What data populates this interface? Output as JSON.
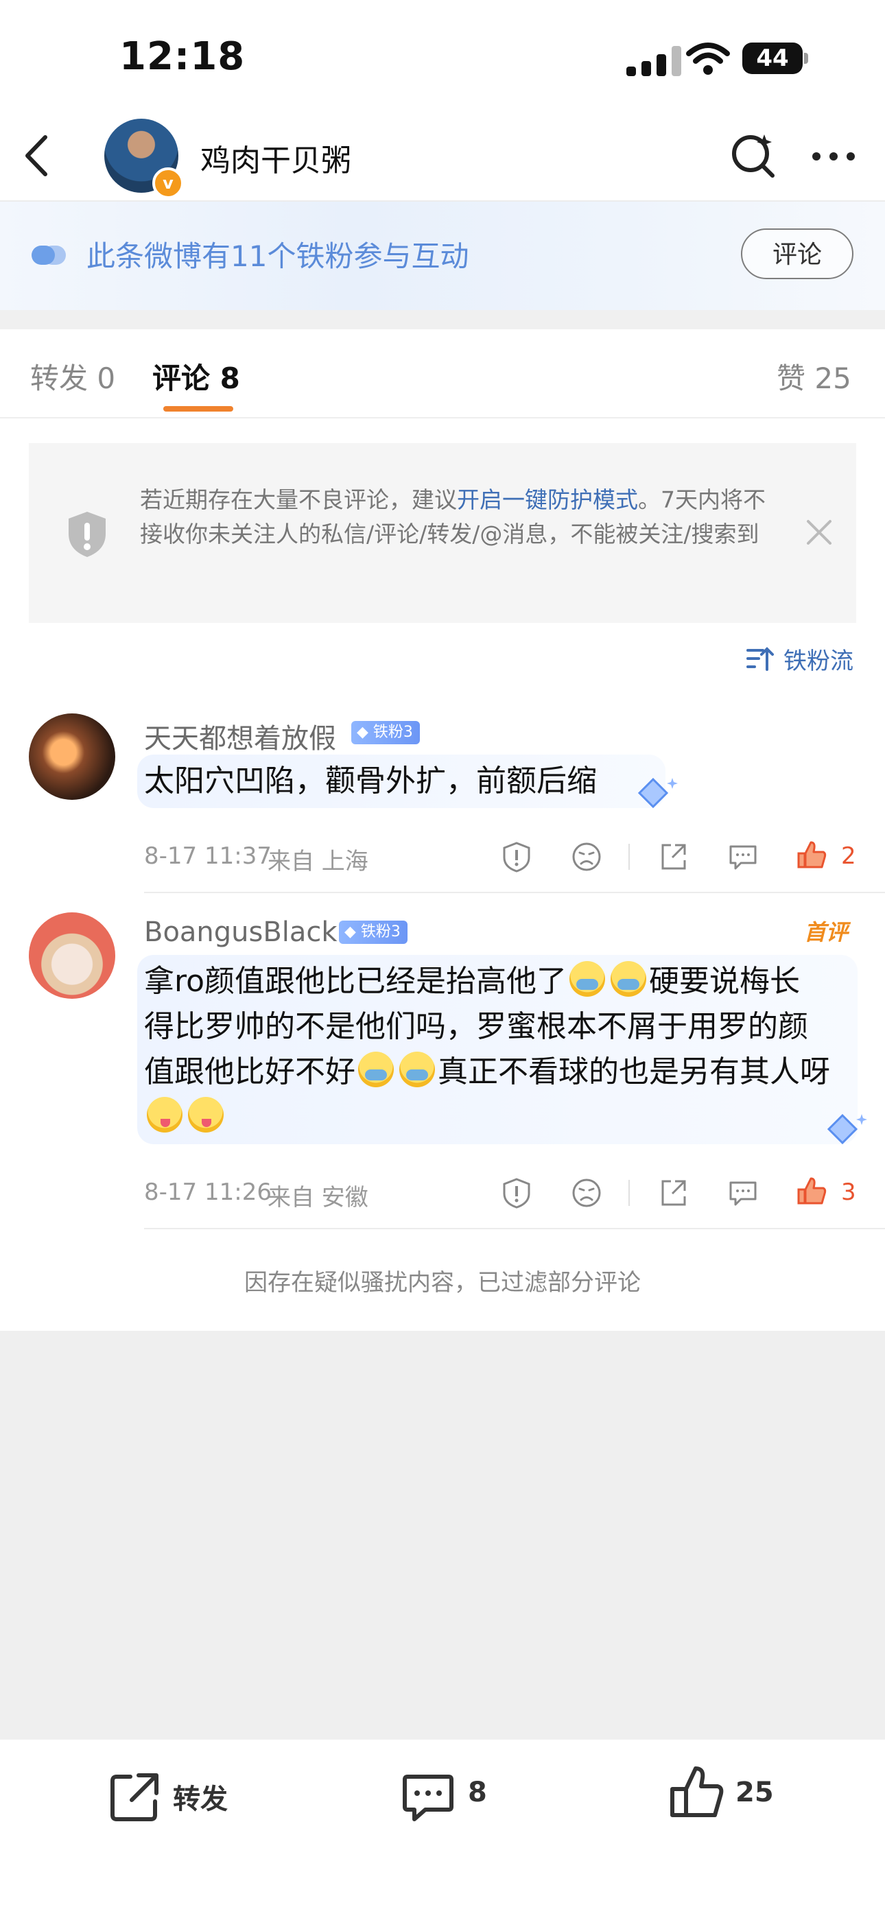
{
  "status": {
    "time": "12:18",
    "battery": "44"
  },
  "header": {
    "title": "鸡肉干贝粥",
    "verified_mark": "v"
  },
  "banner": {
    "text": "此条微博有11个铁粉参与互动",
    "button": "评论"
  },
  "tabs": {
    "repost": "转发 0",
    "comments": "评论 8",
    "likes": "赞 25"
  },
  "notice": {
    "part1": "若近期存在大量不良评论，建议",
    "link": "开启一键防护模式",
    "part2": "。7天内将不接收你未关注人的私信/评论/转发/@消息，不能被关注/搜索到"
  },
  "sort_label": "铁粉流",
  "comments": [
    {
      "user": "天天都想着放假",
      "badge": "铁粉3",
      "text": "太阳穴凹陷，颧骨外扩，前额后缩",
      "time": "8-17 11:37",
      "source": "来自 上海",
      "likes": "2"
    },
    {
      "user": "BoangusBlack",
      "badge": "铁粉3",
      "pin": "首评",
      "text_a": "拿ro颜值跟他比已经是抬高他了",
      "text_b": "硬要说梅长得比罗帅的不是他们吗，罗蜜根本不屑于用罗的颜值跟他比好不好",
      "text_c": "真正不看球的也是另有其人呀",
      "time": "8-17 11:26",
      "source": "来自 安徽",
      "likes": "3"
    }
  ],
  "filtered_note": "因存在疑似骚扰内容，已过滤部分评论",
  "bottom": {
    "repost": "转发",
    "comments": "8",
    "likes": "25"
  },
  "colors": {
    "accent": "#f0822d",
    "link": "#3f6fb6",
    "like": "#e9542f",
    "banner_text": "#5b8bd9"
  }
}
